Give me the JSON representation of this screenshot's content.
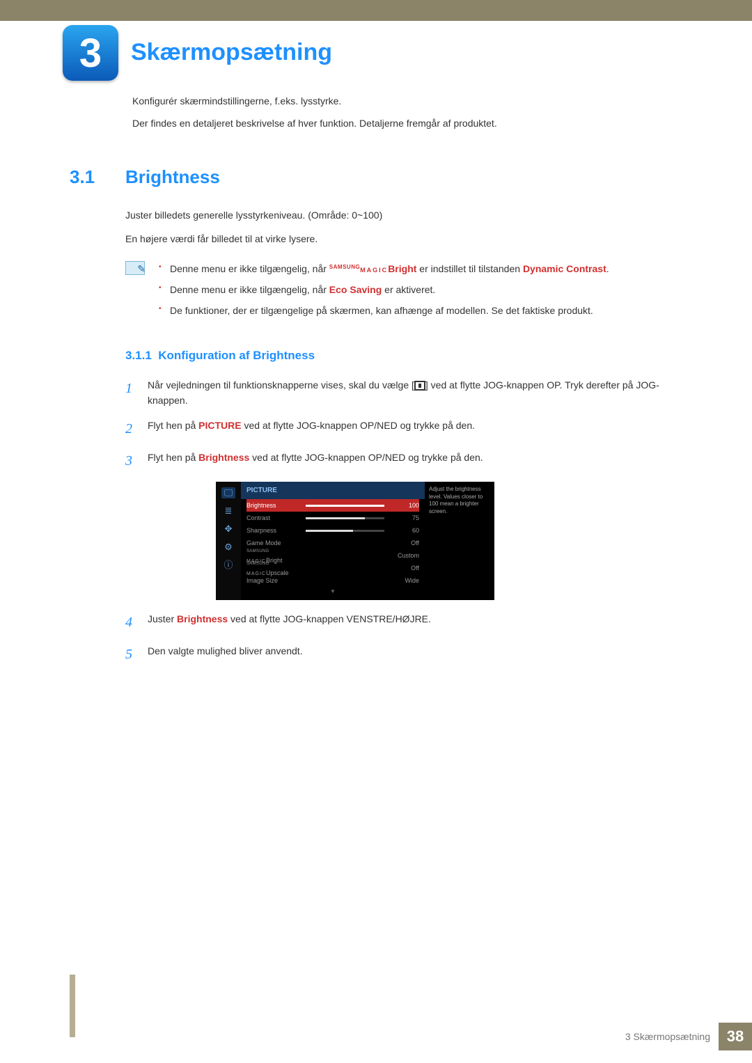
{
  "chapter": {
    "number": "3",
    "title": "Skærmopsætning"
  },
  "intro": {
    "p1": "Konfigurér skærmindstillingerne, f.eks. lysstyrke.",
    "p2": "Der findes en detaljeret beskrivelse af hver funktion. Detaljerne fremgår af produktet."
  },
  "section": {
    "number": "3.1",
    "title": "Brightness",
    "p1": "Juster billedets generelle lysstyrkeniveau. (Område: 0~100)",
    "p2": "En højere værdi får billedet til at virke lysere."
  },
  "notes": {
    "n1_pre": "Denne menu er ikke tilgængelig, når ",
    "n1_magic_top": "SAMSUNG",
    "n1_magic_bot": "MAGIC",
    "n1_bright": "Bright",
    "n1_mid": " er indstillet til tilstanden ",
    "n1_dc": "Dynamic Contrast",
    "n1_end": ".",
    "n2_pre": "Denne menu er ikke tilgængelig, når ",
    "n2_eco": "Eco Saving",
    "n2_end": " er aktiveret.",
    "n3": "De funktioner, der er tilgængelige på skærmen, kan afhænge af modellen. Se det faktiske produkt."
  },
  "subsection": {
    "number": "3.1.1",
    "title": "Konfiguration af Brightness"
  },
  "steps": {
    "s1a": "Når vejledningen til funktionsknapperne vises, skal du vælge [",
    "s1b": "] ved at flytte JOG-knappen OP. Tryk derefter på JOG-knappen.",
    "s2a": "Flyt hen på ",
    "s2_pic": "PICTURE",
    "s2b": " ved at flytte JOG-knappen OP/NED og trykke på den.",
    "s3a": "Flyt hen på ",
    "s3_br": "Brightness",
    "s3b": " ved at flytte JOG-knappen OP/NED og trykke på den.",
    "s4a": "Juster ",
    "s4_br": "Brightness",
    "s4b": " ved at flytte JOG-knappen VENSTRE/HØJRE.",
    "s5": "Den valgte mulighed bliver anvendt."
  },
  "osd": {
    "header": "PICTURE",
    "help": "Adjust the brightness level. Values closer to 100 mean a brighter screen.",
    "rows": [
      {
        "label": "Brightness",
        "value": "100",
        "bar": 100,
        "selected": true
      },
      {
        "label": "Contrast",
        "value": "75",
        "bar": 75,
        "selected": false
      },
      {
        "label": "Sharpness",
        "value": "60",
        "bar": 60,
        "selected": false
      },
      {
        "label": "Game Mode",
        "value": "Off",
        "bar": null,
        "selected": false
      },
      {
        "label": "Bright",
        "value": "Custom",
        "bar": null,
        "selected": false,
        "magic": true
      },
      {
        "label": "Upscale",
        "value": "Off",
        "bar": null,
        "selected": false,
        "magic": true
      },
      {
        "label": "Image Size",
        "value": "Wide",
        "bar": null,
        "selected": false
      }
    ],
    "magic_top": "SAMSUNG",
    "magic_bot": "MAGIC"
  },
  "footer": {
    "text": "3 Skærmopsætning",
    "page": "38"
  }
}
